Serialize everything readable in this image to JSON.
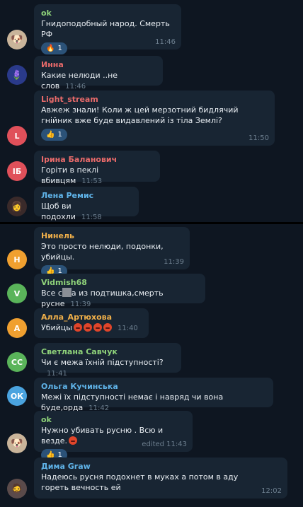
{
  "messages_top": [
    {
      "name": "ok",
      "name_color": "#8fd37a",
      "text": "Гнидоподобный народ. Смерть РФ",
      "reaction_count": "1",
      "reaction_icon": "fire-icon",
      "time": "11:46"
    },
    {
      "name": "Инна",
      "name_color": "#e86a6a",
      "text": "Какие нелюди ..не слов",
      "time": "11:46"
    },
    {
      "name": "Light_stream",
      "name_color": "#e86a6a",
      "text": "Авжеж знали! Коли ж цей мерзотний бидлячий  гнійник вже буде видавлений із тіла Землі?",
      "reaction_count": "1",
      "reaction_icon": "thumbs-up-icon",
      "time": "11:50",
      "avatar_text": "L",
      "avatar_color": "#e0505a"
    },
    {
      "name": "Ірина Баланович",
      "name_color": "#e86a6a",
      "text": "Горіти в пеклі вбивцям",
      "time": "11:53",
      "avatar_text": "ІБ",
      "avatar_color": "#e0505a"
    },
    {
      "name": "Лена Ремис",
      "name_color": "#5fb3e8",
      "text": "Щоб ви подохли",
      "time": "11:58"
    }
  ],
  "messages_bottom": [
    {
      "name": "Нинель",
      "name_color": "#f0b04a",
      "text": "Это просто нелюди, подонки, убийцы.",
      "reaction_count": "1",
      "reaction_icon": "thumbs-up-icon",
      "time": "11:39",
      "avatar_text": "Н",
      "avatar_color": "#f0a030"
    },
    {
      "name": "Vidmish68",
      "name_color": "#8fd37a",
      "text_before": "Все с",
      "text_after": "а из подтишка,смерть русне",
      "time": "11:39",
      "avatar_text": "V",
      "avatar_color": "#5ab45a"
    },
    {
      "name": "Алла_Артюхова",
      "name_color": "#f0b04a",
      "text": "Убийцы",
      "time": "11:40",
      "avatar_text": "А",
      "avatar_color": "#f0a030"
    },
    {
      "name": "Светлана Савчук",
      "name_color": "#8fd37a",
      "text": "Чи є межа їхній підступності?",
      "time": "11:41",
      "avatar_text": "СС",
      "avatar_color": "#5ab45a"
    },
    {
      "name": "Ольга Кучинська",
      "name_color": "#5fb3e8",
      "text": "Межі їх підступності немає і навряд чи вона буде,орда",
      "time": "11:42",
      "avatar_text": "ОК",
      "avatar_color": "#4aa3df"
    },
    {
      "name": "ok",
      "name_color": "#8fd37a",
      "text": "Нужно убивать русню . Всю и везде.",
      "reaction_count": "1",
      "reaction_icon": "thumbs-up-icon",
      "time": "edited 11:43"
    },
    {
      "name": "Дима Graw",
      "name_color": "#5fb3e8",
      "text": "Надеюсь русня подохнет в муках а потом в аду гореть вечность ей",
      "time": "12:02"
    }
  ]
}
